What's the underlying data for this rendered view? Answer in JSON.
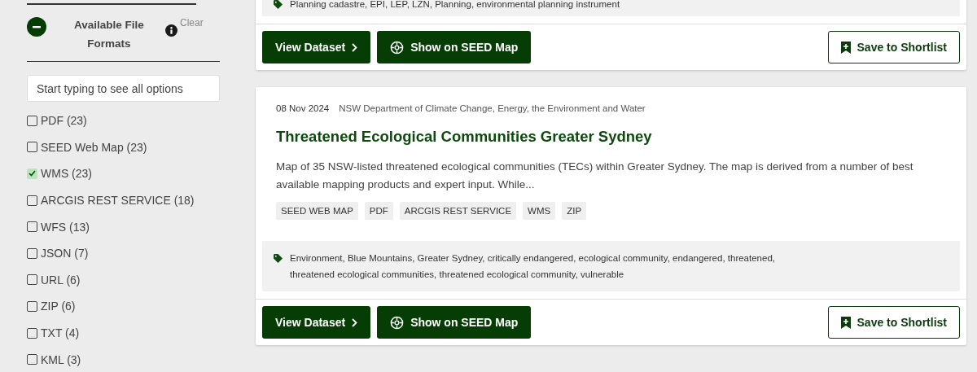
{
  "filter": {
    "title": "Available File Formats",
    "expanded": true,
    "clear": "Clear",
    "search": {
      "placeholder": "Start typing to see all options"
    },
    "options": [
      {
        "label": "PDF (23)",
        "checked": false
      },
      {
        "label": "SEED Web Map (23)",
        "checked": false
      },
      {
        "label": "WMS (23)",
        "checked": true
      },
      {
        "label": "ARCGIS REST SERVICE (18)",
        "checked": false
      },
      {
        "label": "WFS (13)",
        "checked": false
      },
      {
        "label": "JSON (7)",
        "checked": false
      },
      {
        "label": "URL (6)",
        "checked": false
      },
      {
        "label": "ZIP (6)",
        "checked": false
      },
      {
        "label": "TXT (4)",
        "checked": false
      },
      {
        "label": "KML (3)",
        "checked": false
      }
    ]
  },
  "results": [
    {
      "keywords": "Planning cadastre, EPI, LEP, LZN, Planning, environmental planning instrument",
      "buttons": {
        "view": "View Dataset",
        "map": "Show on SEED Map",
        "save": "Save to Shortlist"
      }
    },
    {
      "date": "08 Nov 2024",
      "publisher": "NSW Department of Climate Change, Energy, the Environment and Water",
      "title": "Threatened Ecological Communities Greater Sydney",
      "description": "Map of 35 NSW-listed threatened ecological communities (TECs) within Greater Sydney. The map is derived from a number of best available mapping products and expert input. While...",
      "formats": [
        "SEED WEB MAP",
        "PDF",
        "ARCGIS REST SERVICE",
        "WMS",
        "ZIP"
      ],
      "keywords": "Environment, Blue Mountains, Greater Sydney, critically endangered, ecological community, endangered, threatened, threatened ecological communities, threatened ecological community, vulnerable",
      "buttons": {
        "view": "View Dataset",
        "map": "Show on SEED Map",
        "save": "Save to Shortlist"
      }
    }
  ]
}
